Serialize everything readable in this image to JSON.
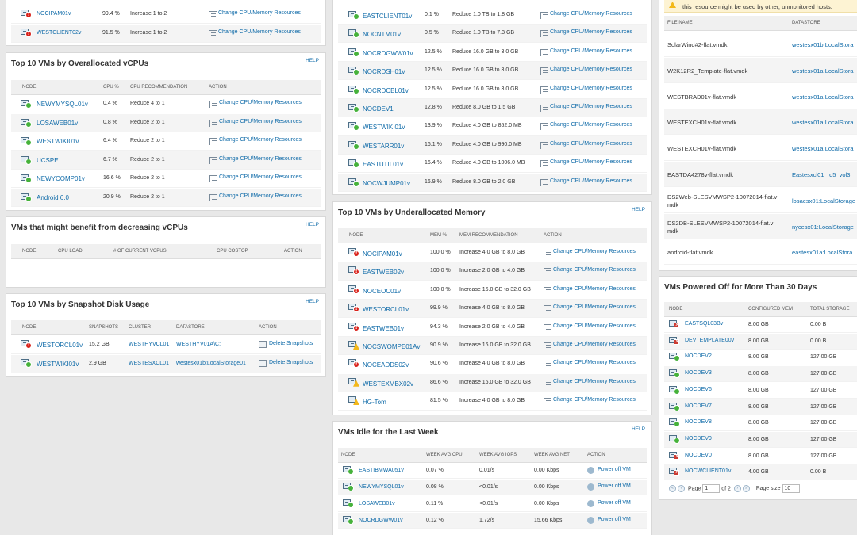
{
  "common": {
    "help": "HELP",
    "change_action": "Change CPU/Memory Resources",
    "delete_action": "Delete Snapshots",
    "power_action": "Power off VM"
  },
  "p1_top": {
    "rows": [
      {
        "node": "NOCIPAM01v",
        "status": "crit",
        "v1": "99.4 %",
        "v2": "Increase 1 to 2"
      },
      {
        "node": "WESTCLIENT02v",
        "status": "crit",
        "v1": "91.5 %",
        "v2": "Increase 1 to 2"
      }
    ]
  },
  "overalloc": {
    "title": "Top 10 VMs by Overallocated vCPUs",
    "headers": [
      "NODE",
      "CPU %",
      "CPU RECOMMENDATION",
      "ACTION"
    ],
    "rows": [
      {
        "node": "NEWYMYSQL01v",
        "status": "up",
        "cpu": "0.4 %",
        "rec": "Reduce 4 to 1"
      },
      {
        "node": "LOSAWEB01v",
        "status": "up",
        "cpu": "0.8 %",
        "rec": "Reduce 2 to 1"
      },
      {
        "node": "WESTWIKI01v",
        "status": "up",
        "cpu": "6.4 %",
        "rec": "Reduce 2 to 1"
      },
      {
        "node": "UCSPE",
        "status": "up",
        "cpu": "6.7 %",
        "rec": "Reduce 2 to 1"
      },
      {
        "node": "NEWYCOMP01v",
        "status": "up",
        "cpu": "16.6 %",
        "rec": "Reduce 2 to 1"
      },
      {
        "node": "Android 6.0",
        "status": "up",
        "cpu": "20.9 %",
        "rec": "Reduce 2 to 1"
      }
    ]
  },
  "decrease": {
    "title": "VMs that might benefit from decreasing vCPUs",
    "headers": [
      "NODE",
      "CPU LOAD",
      "# OF CURRENT VCPUS",
      "CPU COSTOP",
      "ACTION"
    ]
  },
  "snapshot": {
    "title": "Top 10 VMs by Snapshot Disk Usage",
    "headers": [
      "NODE",
      "SNAPSHOTS",
      "CLUSTER",
      "DATASTORE",
      "ACTION"
    ],
    "rows": [
      {
        "node": "WESTORCL01v",
        "status": "crit",
        "snap": "15.2 GB",
        "cluster": "WESTHYVCL01",
        "ds": "WESTHYV01A\\C:"
      },
      {
        "node": "WESTWIKI01v",
        "status": "up",
        "snap": "2.9 GB",
        "cluster": "WESTESXCL01",
        "ds": "westesx01b:LocalStorage01"
      }
    ]
  },
  "overmem": {
    "rows": [
      {
        "node": "EASTCLIENT01v",
        "status": "up",
        "v1": "0.1 %",
        "v2": "Reduce 1.0 TB to 1.8 GB"
      },
      {
        "node": "NOCNTM01v",
        "status": "up",
        "v1": "0.5 %",
        "v2": "Reduce 1.0 TB to 7.3 GB"
      },
      {
        "node": "NOCRDGWW01v",
        "status": "up",
        "v1": "12.5 %",
        "v2": "Reduce 16.0 GB to 3.0 GB"
      },
      {
        "node": "NOCRDSH01v",
        "status": "up",
        "v1": "12.5 %",
        "v2": "Reduce 16.0 GB to 3.0 GB"
      },
      {
        "node": "NOCRDCBL01v",
        "status": "up",
        "v1": "12.5 %",
        "v2": "Reduce 16.0 GB to 3.0 GB"
      },
      {
        "node": "NOCDEV1",
        "status": "up",
        "v1": "12.8 %",
        "v2": "Reduce 8.0 GB to 1.5 GB"
      },
      {
        "node": "WESTWIKI01v",
        "status": "up",
        "v1": "13.9 %",
        "v2": "Reduce 4.0 GB to 852.0 MB"
      },
      {
        "node": "WESTARR01v",
        "status": "up",
        "v1": "16.1 %",
        "v2": "Reduce 4.0 GB to 990.0 MB"
      },
      {
        "node": "EASTUTIL01v",
        "status": "up",
        "v1": "16.4 %",
        "v2": "Reduce 4.0 GB to 1006.0 MB"
      },
      {
        "node": "NOCWJUMP01v",
        "status": "up",
        "v1": "16.9 %",
        "v2": "Reduce 8.0 GB to 2.0 GB"
      }
    ]
  },
  "undermem": {
    "title": "Top 10 VMs by Underallocated Memory",
    "headers": [
      "NODE",
      "MEM %",
      "MEM RECOMMENDATION",
      "ACTION"
    ],
    "rows": [
      {
        "node": "NOCIPAM01v",
        "status": "crit",
        "mem": "100.0 %",
        "rec": "Increase 4.0 GB to 8.0 GB"
      },
      {
        "node": "EASTWEB02v",
        "status": "crit",
        "mem": "100.0 %",
        "rec": "Increase 2.0 GB to 4.0 GB"
      },
      {
        "node": "NOCEOC01v",
        "status": "crit",
        "mem": "100.0 %",
        "rec": "Increase 16.0 GB to 32.0 GB"
      },
      {
        "node": "WESTORCL01v",
        "status": "crit",
        "mem": "99.9 %",
        "rec": "Increase 4.0 GB to 8.0 GB"
      },
      {
        "node": "EASTWEB01v",
        "status": "crit",
        "mem": "94.3 %",
        "rec": "Increase 2.0 GB to 4.0 GB"
      },
      {
        "node": "NOCSWOMPE01Av",
        "status": "warn",
        "mem": "90.9 %",
        "rec": "Increase 16.0 GB to 32.0 GB"
      },
      {
        "node": "NOCEADDS02v",
        "status": "crit",
        "mem": "90.6 %",
        "rec": "Increase 4.0 GB to 8.0 GB"
      },
      {
        "node": "WESTEXMBX02v",
        "status": "warn",
        "mem": "86.6 %",
        "rec": "Increase 16.0 GB to 32.0 GB"
      },
      {
        "node": "HG-Tom",
        "status": "warn",
        "mem": "81.5 %",
        "rec": "Increase 4.0 GB to 8.0 GB"
      }
    ]
  },
  "idle": {
    "title": "VMs Idle for the Last Week",
    "headers": [
      "NODE",
      "WEEK AVG CPU",
      "WEEK AVG IOPS",
      "WEEK AVG NET",
      "ACTION"
    ],
    "rows": [
      {
        "node": "EASTIBMWA051v",
        "status": "up",
        "cpu": "0.07 %",
        "iops": "0.01/s",
        "net": "0.00 Kbps"
      },
      {
        "node": "NEWYMYSQL01v",
        "status": "up",
        "cpu": "0.08 %",
        "iops": "<0.01/s",
        "net": "0.00 Kbps"
      },
      {
        "node": "LOSAWEB01v",
        "status": "up",
        "cpu": "0.11 %",
        "iops": "<0.01/s",
        "net": "0.00 Kbps"
      },
      {
        "node": "NOCRDGWW01v",
        "status": "up",
        "cpu": "0.12 %",
        "iops": "1.72/s",
        "net": "15.66 Kbps"
      }
    ]
  },
  "orphan": {
    "warning": "this resource might be used by other, unmonitored hosts.",
    "headers": [
      "FILE NAME",
      "DATASTORE"
    ],
    "rows": [
      {
        "file": "SolarWind#2-flat.vmdk",
        "ds": "westesx01b:LocalStora"
      },
      {
        "file": "W2K12R2_Template-flat.vmdk",
        "ds": "westesx01a:LocalStora"
      },
      {
        "file": "WESTBRAD01v-flat.vmdk",
        "ds": "westesx01a:LocalStora"
      },
      {
        "file": "WESTEXCH01v-flat.vmdk",
        "ds": "westesx01a:LocalStora"
      },
      {
        "file": "WESTEXCH01v-flat.vmdk",
        "ds": "westesx01a:LocalStora"
      },
      {
        "file": "EASTDA4278v-flat.vmdk",
        "ds": "Eastesxcl01_rd5_vol3"
      },
      {
        "file": "DS2Web-SLESVMWSP2-10072014-flat.v",
        "file2": "mdk",
        "ds": "losaesx01:LocalStorage"
      },
      {
        "file": "DS2DB-SLESVMWSP2-10072014-flat.v",
        "file2": "mdk",
        "ds": "nycesx01:LocalStorage"
      },
      {
        "file": "android-flat.vmdk",
        "ds": "eastesx01a:LocalStora"
      }
    ]
  },
  "poweredoff": {
    "title": "VMs Powered Off for More Than 30 Days",
    "headers": [
      "NODE",
      "CONFIGURED MEM",
      "TOTAL STORAGE"
    ],
    "rows": [
      {
        "node": "EASTSQL03Bv",
        "status": "off",
        "mem": "8.00 GB",
        "st": "0.00 B"
      },
      {
        "node": "DEVTEMPLATE00v",
        "status": "off",
        "mem": "8.00 GB",
        "st": "0.00 B"
      },
      {
        "node": "NOCDEV2",
        "status": "up",
        "mem": "8.00 GB",
        "st": "127.00 GB"
      },
      {
        "node": "NOCDEV3",
        "status": "up",
        "mem": "8.00 GB",
        "st": "127.00 GB"
      },
      {
        "node": "NOCDEV6",
        "status": "up",
        "mem": "8.00 GB",
        "st": "127.00 GB"
      },
      {
        "node": "NOCDEV7",
        "status": "up",
        "mem": "8.00 GB",
        "st": "127.00 GB"
      },
      {
        "node": "NOCDEV8",
        "status": "up",
        "mem": "8.00 GB",
        "st": "127.00 GB"
      },
      {
        "node": "NOCDEV9",
        "status": "up",
        "mem": "8.00 GB",
        "st": "127.00 GB"
      },
      {
        "node": "NOCDEV0",
        "status": "off",
        "mem": "8.00 GB",
        "st": "127.00 GB"
      },
      {
        "node": "NOCWCLIENT01v",
        "status": "off",
        "mem": "4.00 GB",
        "st": "0.00 B"
      }
    ],
    "pager": {
      "page_label": "Page",
      "page_value": "1",
      "of_label": "of 2",
      "size_label": "Page size",
      "size_value": "10"
    }
  }
}
